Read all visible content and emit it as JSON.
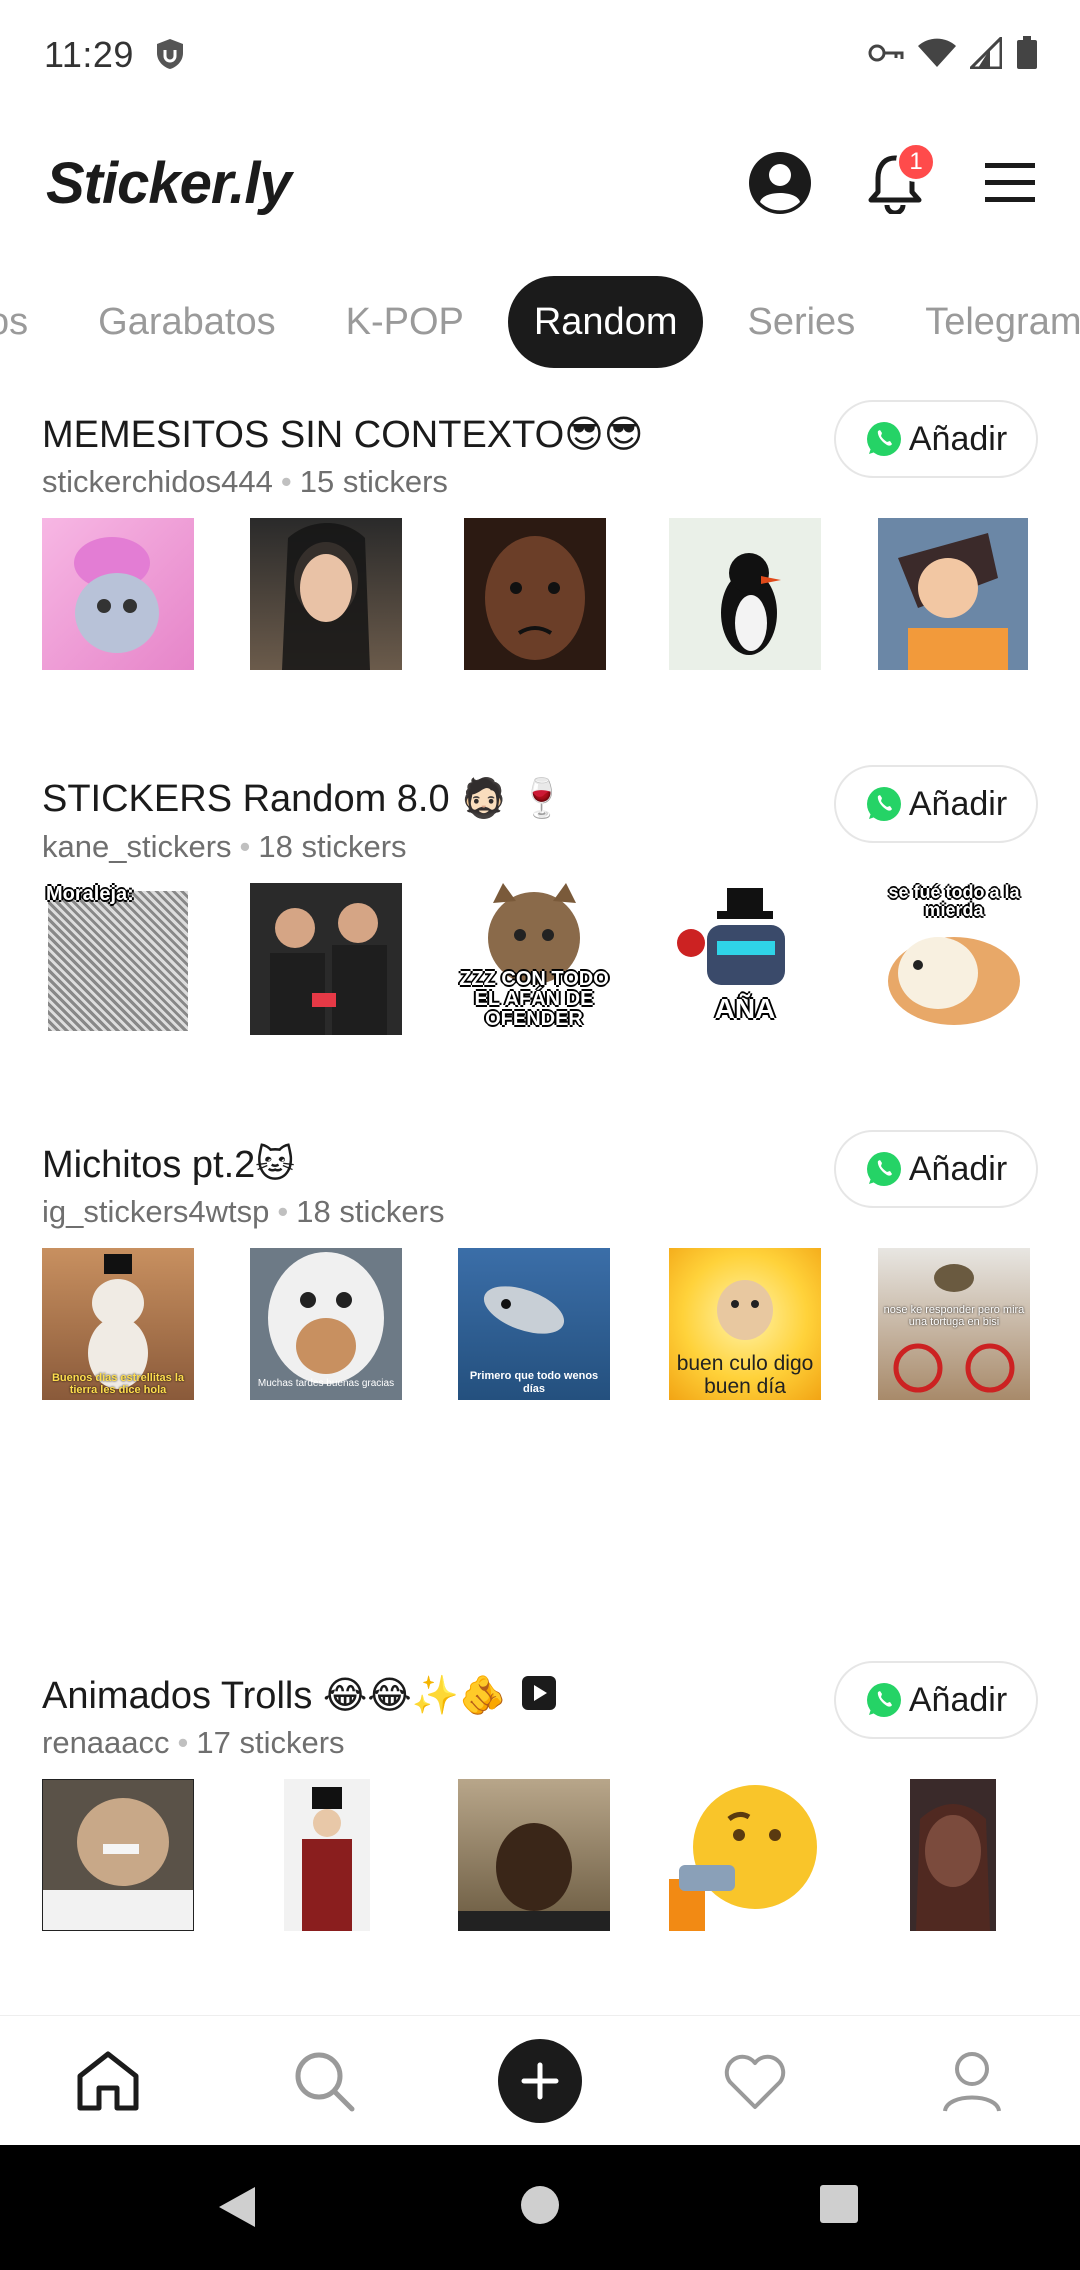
{
  "status": {
    "time": "11:29"
  },
  "app": {
    "logo": "Sticker.ly",
    "notifications_count": "1"
  },
  "tabs": [
    {
      "label": "os",
      "active": false
    },
    {
      "label": "Garabatos",
      "active": false
    },
    {
      "label": "K-POP",
      "active": false
    },
    {
      "label": "Random",
      "active": true
    },
    {
      "label": "Series",
      "active": false
    },
    {
      "label": "Telegram",
      "active": false
    }
  ],
  "packs": [
    {
      "title": "MEMESITOS SIN CONTEXTO😎😎",
      "author": "stickerchidos444",
      "count": "15 stickers",
      "add_label": "Añadir",
      "stickers": [
        {
          "caption": ""
        },
        {
          "caption": ""
        },
        {
          "caption": ""
        },
        {
          "caption": ""
        },
        {
          "caption": ""
        }
      ]
    },
    {
      "title": "STICKERS Random 8.0 🧔🏻 🍷",
      "author": "kane_stickers",
      "count": "18 stickers",
      "add_label": "Añadir",
      "stickers": [
        {
          "caption": "Moraleja:"
        },
        {
          "caption": ""
        },
        {
          "caption": "ZZZ CON TODO EL AFÁN DE OFENDER"
        },
        {
          "caption": "AÑA"
        },
        {
          "caption": "se fué todo a la mierda"
        }
      ]
    },
    {
      "title": "Michitos pt.2🐱",
      "author": "ig_stickers4wtsp",
      "count": "18 stickers",
      "add_label": "Añadir",
      "stickers": [
        {
          "caption": "Buenos días estrellitas la tierra les dice hola"
        },
        {
          "caption": "Muchas tardes buenas gracias"
        },
        {
          "caption": "Primero que todo wenos días"
        },
        {
          "caption": "buen culo digo buen día"
        },
        {
          "caption": "nose ke responder pero mira una tortuga en bisi"
        }
      ]
    },
    {
      "title": "Animados Trolls 😂😂✨🫵",
      "author": "renaaacc",
      "count": "17 stickers",
      "add_label": "Añadir",
      "stickers": [
        {
          "caption": ""
        },
        {
          "caption": ""
        },
        {
          "caption": ""
        },
        {
          "caption": ""
        },
        {
          "caption": ""
        }
      ]
    }
  ],
  "colors": {
    "accent": "#1b1b1b",
    "badge": "#ff4b4b",
    "whatsapp": "#25d366"
  }
}
